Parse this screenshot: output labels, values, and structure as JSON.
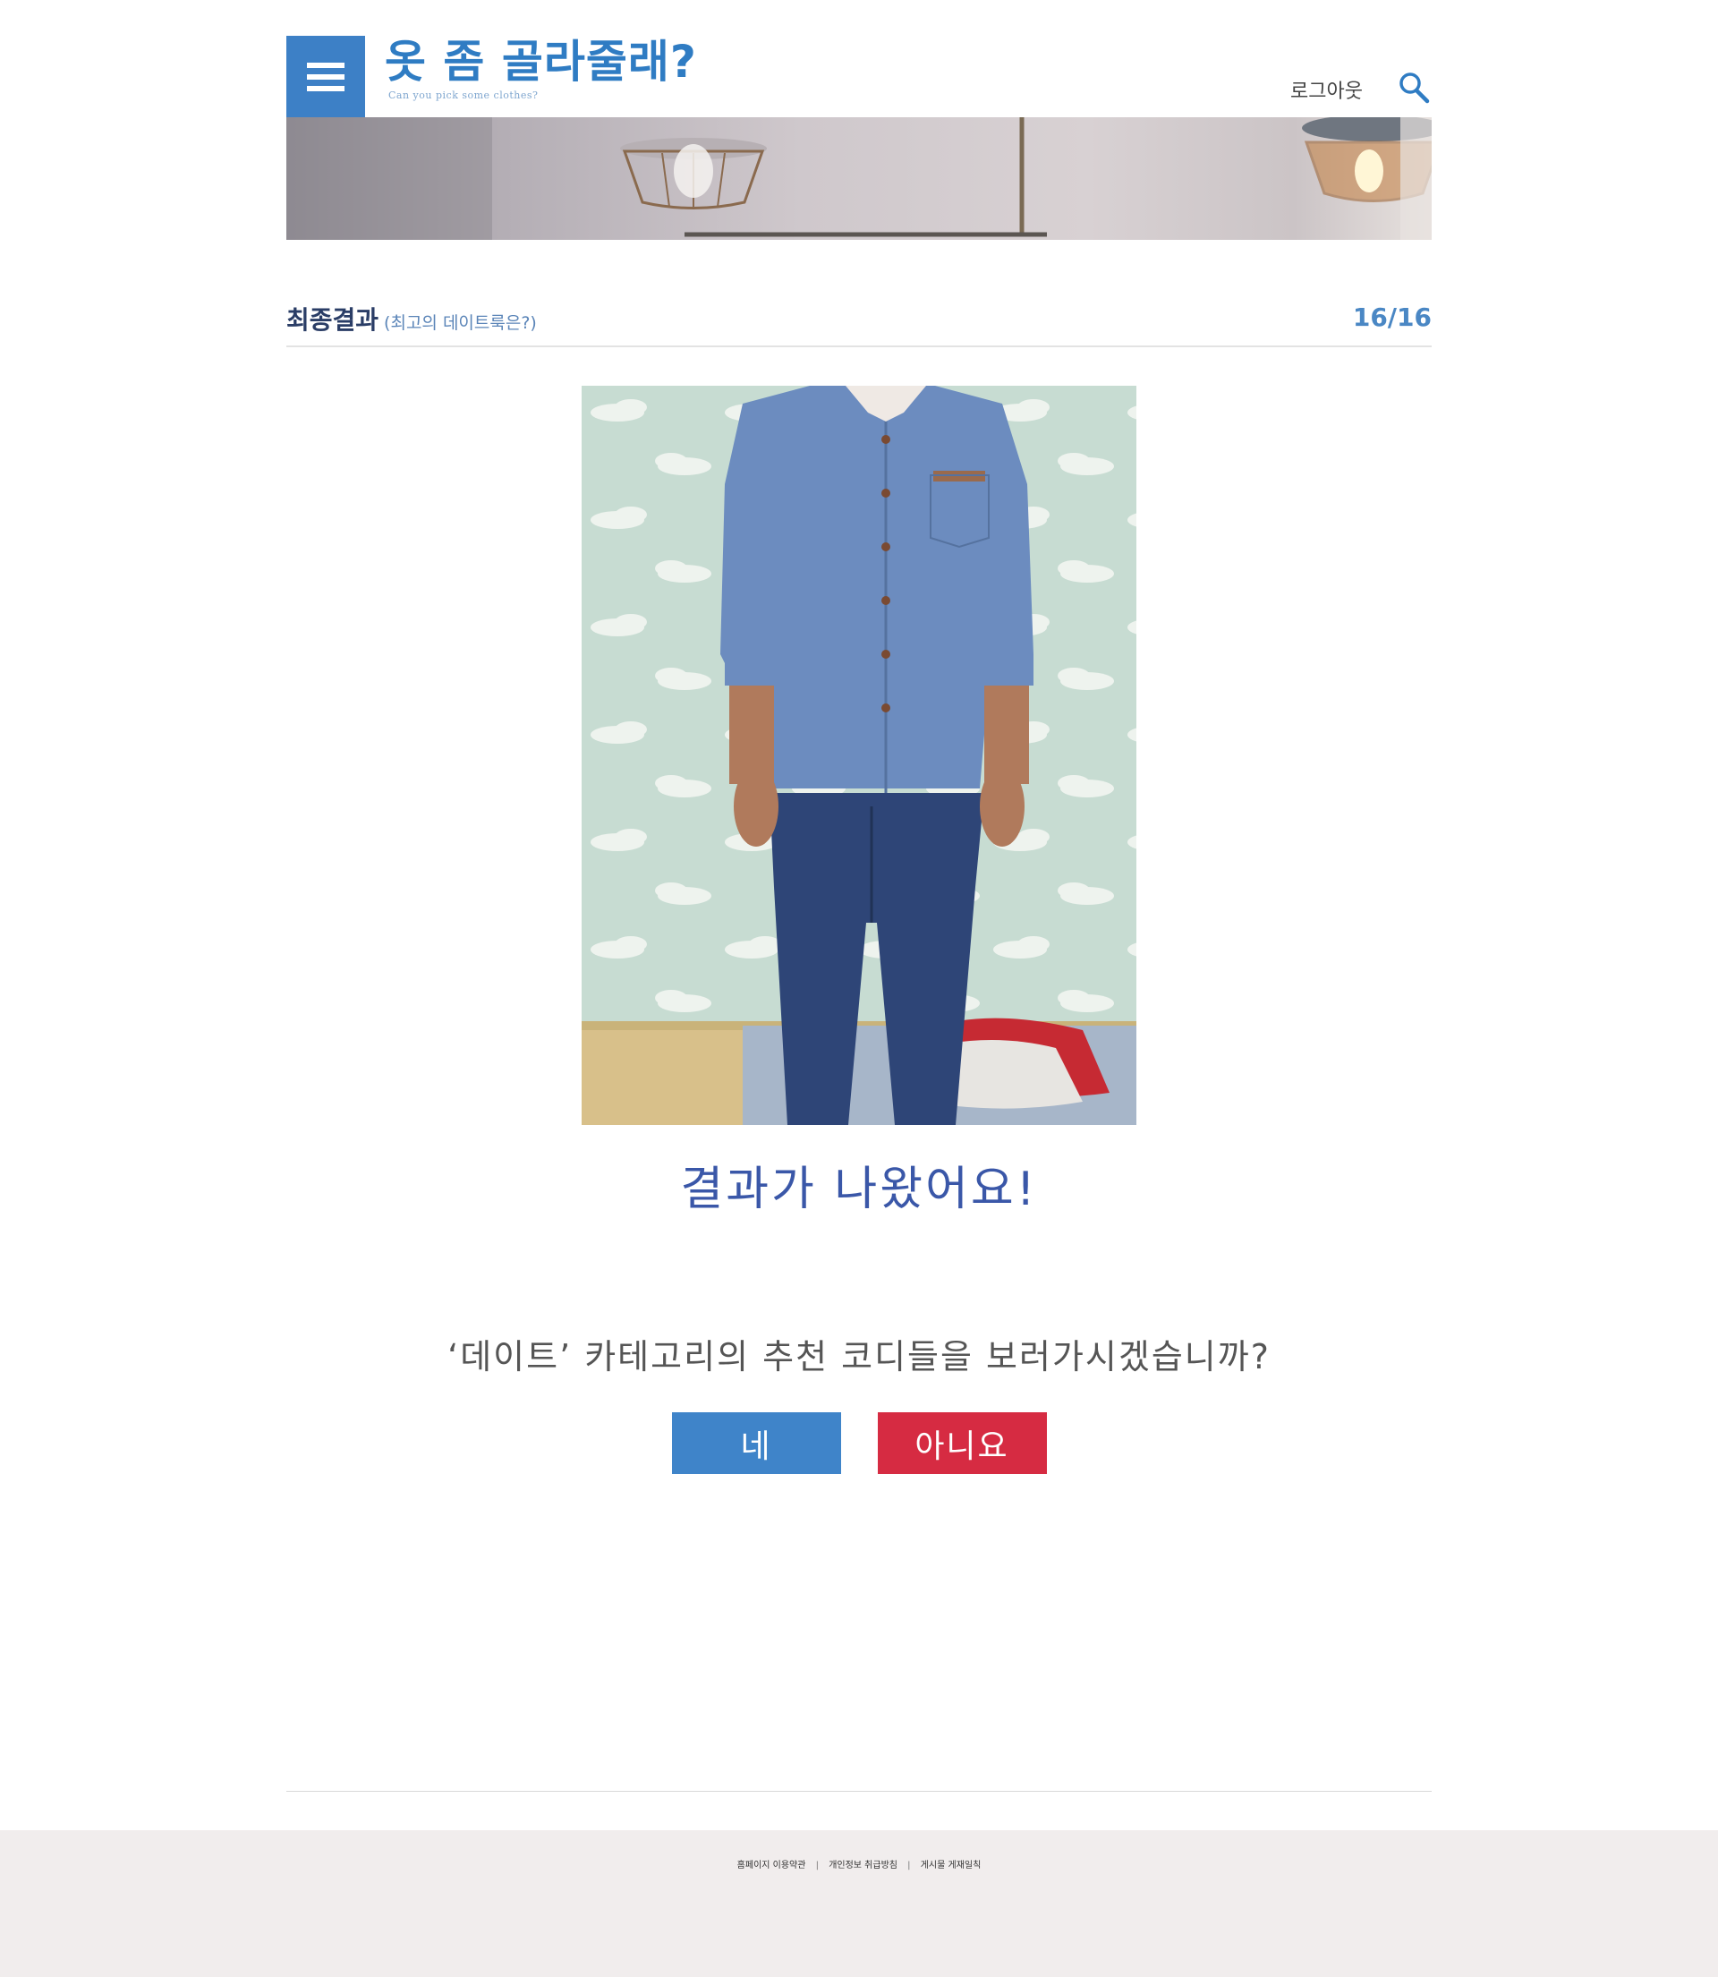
{
  "header": {
    "logo_title": "옷 좀 골라줄래?",
    "logo_subtitle": "Can you pick some clothes?",
    "logout_label": "로그아웃",
    "menu_icon": "hamburger-icon",
    "search_icon": "search-icon"
  },
  "section": {
    "title": "최종결과",
    "subtitle": "(최고의 데이트룩은?)",
    "progress": "16/16"
  },
  "result": {
    "title": "결과가 나왔어요!",
    "question": "‘데이트’ 카테고리의 추천 코디들을 보러가시겠습니까?",
    "yes_label": "네",
    "no_label": "아니요"
  },
  "footer": {
    "links": [
      "홈페이지 이용약관",
      "개인정보 취급방침",
      "게시물 게재일칙"
    ],
    "separator": "|"
  },
  "colors": {
    "brand_blue": "#3d80c6",
    "title_navy": "#2a3d66",
    "yes_button": "#3f84c9",
    "no_button": "#d62b42",
    "footer_bg": "#f1eded"
  }
}
